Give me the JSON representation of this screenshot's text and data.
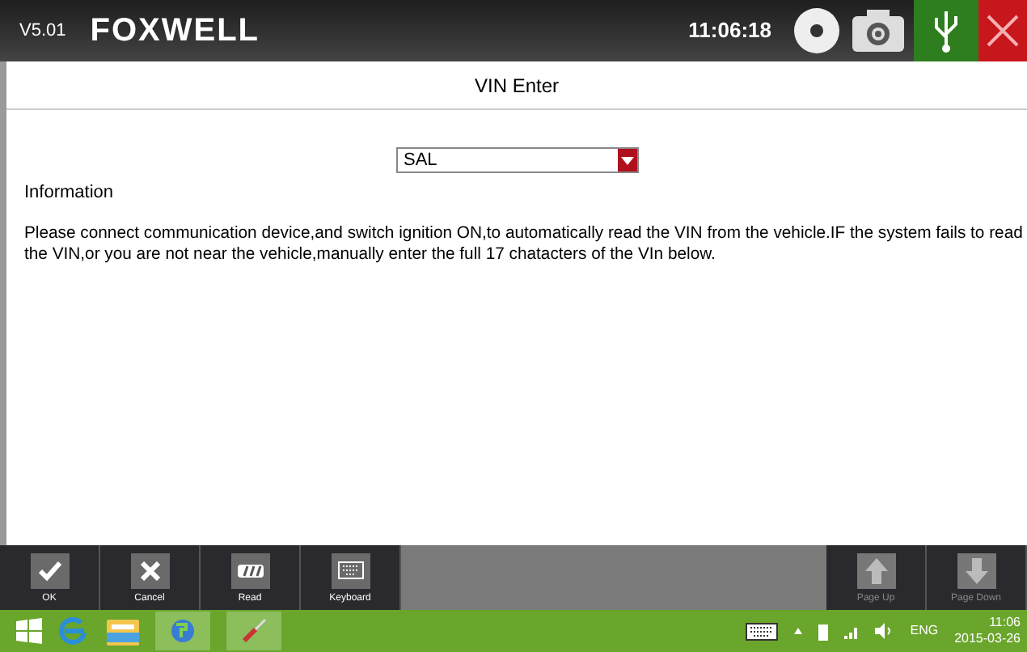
{
  "header": {
    "version": "V5.01",
    "logo": "FOXWELL",
    "time": "11:06:18"
  },
  "page_title": "VIN Enter",
  "vin_select": {
    "value": "SAL"
  },
  "info_label": "Information",
  "info_text": "Please connect communication device,and switch ignition ON,to automatically read the VIN from the vehicle.IF the system fails to read the VIN,or you are not near the vehicle,manually enter the full 17 chatacters of the VIn below.",
  "toolbar_left": [
    {
      "kind": "ok",
      "label": "OK",
      "disabled": false
    },
    {
      "kind": "cancel",
      "label": "Cancel",
      "disabled": false
    },
    {
      "kind": "read",
      "label": "Read",
      "disabled": false
    },
    {
      "kind": "keyboard",
      "label": "Keyboard",
      "disabled": false
    }
  ],
  "toolbar_right": [
    {
      "kind": "up",
      "label": "Page Up",
      "disabled": true
    },
    {
      "kind": "down",
      "label": "Page Down",
      "disabled": true
    }
  ],
  "taskbar": {
    "language": "ENG",
    "clock_time": "11:06",
    "clock_date": "2015-03-26"
  }
}
